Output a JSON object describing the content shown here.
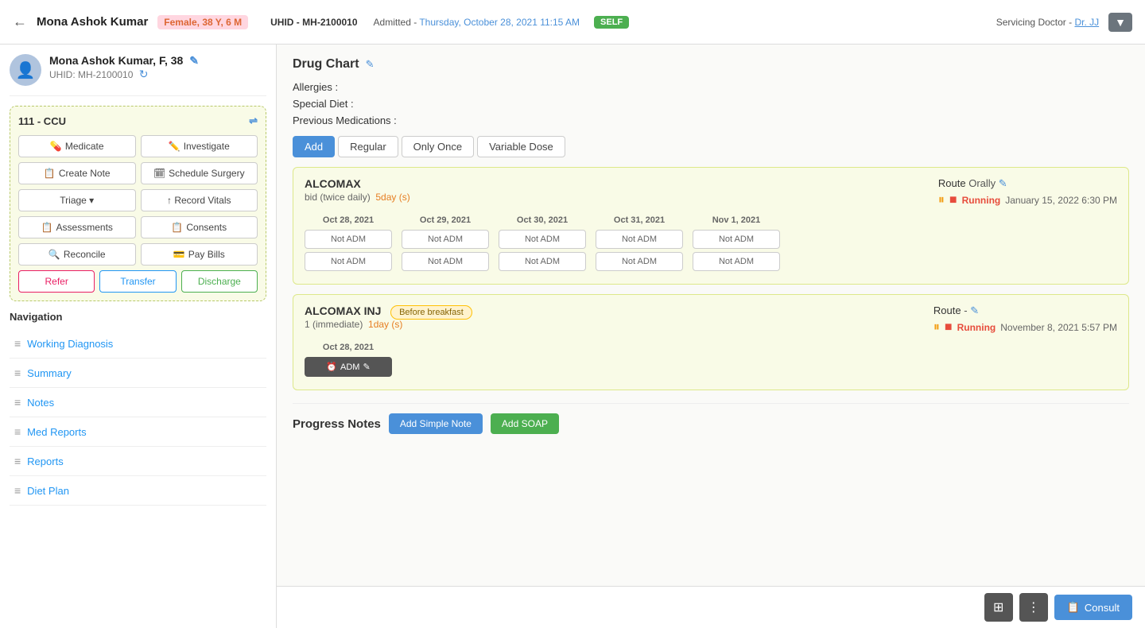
{
  "header": {
    "back_label": "←",
    "patient_name": "Mona Ashok Kumar",
    "gender_age": "Female, 38 Y, 6 M",
    "uhid_label": "UHID -",
    "uhid_value": "MH-2100010",
    "admitted_label": "Admitted -",
    "admitted_date": "Thursday, October 28, 2021 11:15 AM",
    "self_badge": "SELF",
    "servicing_label": "Servicing Doctor -",
    "servicing_doctor": "Dr. JJ",
    "dropdown_icon": "▼"
  },
  "sidebar": {
    "patient_name": "Mona Ashok Kumar, F, 38",
    "uhid_label": "UHID:",
    "uhid_value": "MH-2100010",
    "room": "111 - CCU",
    "actions": [
      {
        "id": "medicate",
        "label": "Medicate",
        "icon": "💊"
      },
      {
        "id": "investigate",
        "label": "Investigate",
        "icon": "✏️"
      },
      {
        "id": "create-note",
        "label": "Create Note",
        "icon": "📋"
      },
      {
        "id": "schedule-surgery",
        "label": "Schedule Surgery",
        "icon": "🗓"
      },
      {
        "id": "triage",
        "label": "Triage ▾",
        "icon": ""
      },
      {
        "id": "record-vitals",
        "label": "↑ Record Vitals",
        "icon": ""
      },
      {
        "id": "assessments",
        "label": "Assessments",
        "icon": "📋"
      },
      {
        "id": "consents",
        "label": "Consents",
        "icon": "📋"
      },
      {
        "id": "reconcile",
        "label": "Reconcile",
        "icon": "🔍"
      },
      {
        "id": "pay-bills",
        "label": "Pay Bills",
        "icon": "💳"
      }
    ],
    "footer_actions": [
      {
        "id": "refer",
        "label": "Refer",
        "class": "refer"
      },
      {
        "id": "transfer",
        "label": "Transfer",
        "class": "transfer"
      },
      {
        "id": "discharge",
        "label": "Discharge",
        "class": "discharge"
      }
    ],
    "nav_title": "Navigation",
    "nav_items": [
      {
        "id": "working-diagnosis",
        "label": "Working Diagnosis"
      },
      {
        "id": "summary",
        "label": "Summary"
      },
      {
        "id": "notes",
        "label": "Notes"
      },
      {
        "id": "med-reports",
        "label": "Med Reports"
      },
      {
        "id": "reports",
        "label": "Reports"
      },
      {
        "id": "diet-plan",
        "label": "Diet Plan"
      }
    ]
  },
  "drug_chart": {
    "title": "Drug Chart",
    "allergies_label": "Allergies :",
    "special_diet_label": "Special Diet :",
    "previous_medications_label": "Previous Medications :",
    "tabs": [
      {
        "id": "add",
        "label": "Add",
        "active": true
      },
      {
        "id": "regular",
        "label": "Regular"
      },
      {
        "id": "only-once",
        "label": "Only Once"
      },
      {
        "id": "variable-dose",
        "label": "Variable Dose"
      }
    ],
    "drugs": [
      {
        "name": "ALCOMAX",
        "route": "Orally",
        "dosage": "bid (twice daily)",
        "duration": "5day (s)",
        "status": "Running",
        "status_date": "January 15, 2022 6:30 PM",
        "dates": [
          "Oct 28, 2021",
          "Oct 29, 2021",
          "Oct 30, 2021",
          "Oct 31, 2021",
          "Nov 1, 2021"
        ],
        "cells": [
          [
            "Not ADM",
            "Not ADM"
          ],
          [
            "Not ADM",
            "Not ADM"
          ],
          [
            "Not ADM",
            "Not ADM"
          ],
          [
            "Not ADM",
            "Not ADM"
          ],
          [
            "Not ADM",
            "Not ADM"
          ]
        ]
      },
      {
        "name": "ALCOMAX INJ",
        "badge": "Before breakfast",
        "route": "-",
        "dosage": "1 (immediate)",
        "duration": "1day (s)",
        "status": "Running",
        "status_date": "November 8, 2021 5:57 PM",
        "dates": [
          "Oct 28, 2021"
        ],
        "cells": [
          [
            "ADM"
          ]
        ]
      }
    ]
  },
  "progress_notes": {
    "title": "Progress Notes",
    "add_simple_note_label": "Add Simple Note",
    "add_soap_label": "Add SOAP"
  },
  "bottom_bar": {
    "grid_icon": "⊞",
    "more_icon": "⋮",
    "consult_label": "Consult",
    "consult_icon": "📋"
  }
}
